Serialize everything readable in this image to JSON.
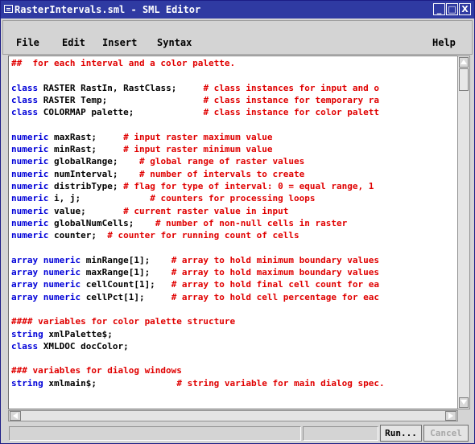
{
  "window": {
    "title": "RasterIntervals.sml - SML Editor",
    "controls": [
      "_",
      "□",
      "X"
    ]
  },
  "menu": {
    "items": [
      "File",
      "Edit",
      "Insert",
      "Syntax"
    ],
    "help": "Help"
  },
  "editor": {
    "lines": [
      [
        {
          "t": "cm",
          "s": "##  for each interval and a color palette."
        }
      ],
      [],
      [
        {
          "t": "kw",
          "s": "class"
        },
        {
          "t": "id",
          "s": " RASTER RastIn, RastClass;     "
        },
        {
          "t": "cm",
          "s": "# class instances for input and o"
        }
      ],
      [
        {
          "t": "kw",
          "s": "class"
        },
        {
          "t": "id",
          "s": " RASTER Temp;                  "
        },
        {
          "t": "cm",
          "s": "# class instance for temporary ra"
        }
      ],
      [
        {
          "t": "kw",
          "s": "class"
        },
        {
          "t": "id",
          "s": " COLORMAP palette;             "
        },
        {
          "t": "cm",
          "s": "# class instance for color palett"
        }
      ],
      [],
      [
        {
          "t": "kw",
          "s": "numeric"
        },
        {
          "t": "id",
          "s": " maxRast;     "
        },
        {
          "t": "cm",
          "s": "# input raster maximum value"
        }
      ],
      [
        {
          "t": "kw",
          "s": "numeric"
        },
        {
          "t": "id",
          "s": " minRast;     "
        },
        {
          "t": "cm",
          "s": "# input raster minimum value"
        }
      ],
      [
        {
          "t": "kw",
          "s": "numeric"
        },
        {
          "t": "id",
          "s": " globalRange;    "
        },
        {
          "t": "cm",
          "s": "# global range of raster values"
        }
      ],
      [
        {
          "t": "kw",
          "s": "numeric"
        },
        {
          "t": "id",
          "s": " numInterval;    "
        },
        {
          "t": "cm",
          "s": "# number of intervals to create"
        }
      ],
      [
        {
          "t": "kw",
          "s": "numeric"
        },
        {
          "t": "id",
          "s": " distribType; "
        },
        {
          "t": "cm",
          "s": "# flag for type of interval: 0 = equal range, 1"
        }
      ],
      [
        {
          "t": "kw",
          "s": "numeric"
        },
        {
          "t": "id",
          "s": " i, j;             "
        },
        {
          "t": "cm",
          "s": "# counters for processing loops"
        }
      ],
      [
        {
          "t": "kw",
          "s": "numeric"
        },
        {
          "t": "id",
          "s": " value;       "
        },
        {
          "t": "cm",
          "s": "# current raster value in input"
        }
      ],
      [
        {
          "t": "kw",
          "s": "numeric"
        },
        {
          "t": "id",
          "s": " globalNumCells;    "
        },
        {
          "t": "cm",
          "s": "# number of non-null cells in raster"
        }
      ],
      [
        {
          "t": "kw",
          "s": "numeric"
        },
        {
          "t": "id",
          "s": " counter;  "
        },
        {
          "t": "cm",
          "s": "# counter for running count of cells"
        }
      ],
      [],
      [
        {
          "t": "kw",
          "s": "array numeric"
        },
        {
          "t": "id",
          "s": " minRange[1];    "
        },
        {
          "t": "cm",
          "s": "# array to hold minimum boundary values"
        }
      ],
      [
        {
          "t": "kw",
          "s": "array numeric"
        },
        {
          "t": "id",
          "s": " maxRange[1];    "
        },
        {
          "t": "cm",
          "s": "# array to hold maximum boundary values"
        }
      ],
      [
        {
          "t": "kw",
          "s": "array numeric"
        },
        {
          "t": "id",
          "s": " cellCount[1];   "
        },
        {
          "t": "cm",
          "s": "# array to hold final cell count for ea"
        }
      ],
      [
        {
          "t": "kw",
          "s": "array numeric"
        },
        {
          "t": "id",
          "s": " cellPct[1];     "
        },
        {
          "t": "cm",
          "s": "# array to hold cell percentage for eac"
        }
      ],
      [],
      [
        {
          "t": "cm",
          "s": "#### variables for color palette structure"
        }
      ],
      [
        {
          "t": "kw",
          "s": "string"
        },
        {
          "t": "id",
          "s": " xmlPalette$;"
        }
      ],
      [
        {
          "t": "kw",
          "s": "class"
        },
        {
          "t": "id",
          "s": " XMLDOC docColor;"
        }
      ],
      [],
      [
        {
          "t": "cm",
          "s": "### variables for dialog windows"
        }
      ],
      [
        {
          "t": "kw",
          "s": "string"
        },
        {
          "t": "id",
          "s": " xmlmain$;               "
        },
        {
          "t": "cm",
          "s": "# string variable for main dialog spec."
        }
      ]
    ]
  },
  "buttons": {
    "run": "Run...",
    "cancel": "Cancel"
  },
  "colors": {
    "titlebar": "#2f3aa2",
    "keyword": "#0000d8",
    "comment": "#e00000",
    "identifier": "#000000"
  }
}
